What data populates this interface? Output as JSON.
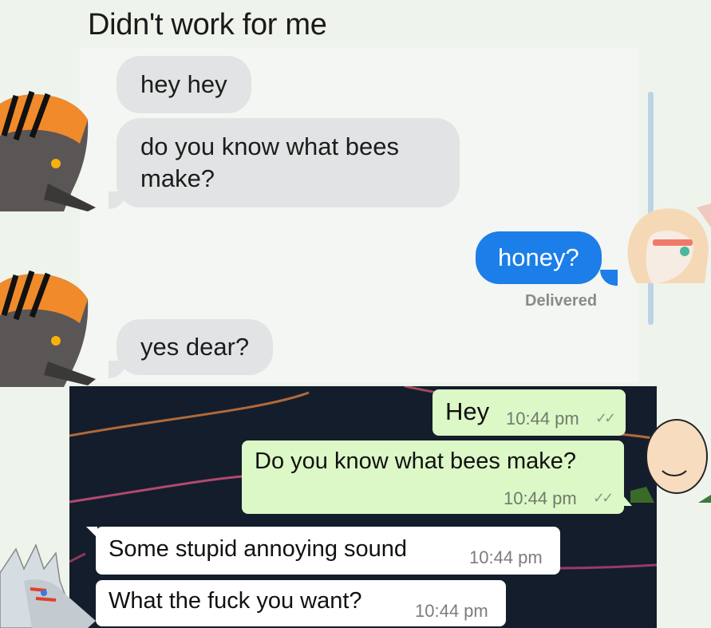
{
  "title": "Didn't work for me",
  "imessage": {
    "messages": [
      {
        "side": "received",
        "text": "hey hey"
      },
      {
        "side": "received",
        "text": "do you know what bees make?"
      },
      {
        "side": "sent",
        "text": "honey?"
      },
      {
        "side": "received",
        "text": "yes dear?"
      }
    ],
    "delivered_label": "Delivered"
  },
  "whatsapp": {
    "messages": [
      {
        "side": "sent",
        "text": "Hey",
        "time": "10:44 pm"
      },
      {
        "side": "sent",
        "text": "Do you know what bees make?",
        "time": "10:44 pm"
      },
      {
        "side": "received",
        "text": "Some stupid annoying sound",
        "time": "10:44 pm"
      },
      {
        "side": "received",
        "text": "What the fuck you want?",
        "time": "10:44 pm"
      }
    ],
    "read_tick": "✓✓"
  },
  "colors": {
    "imessage_blue": "#1c7ee8",
    "imessage_grey": "#e2e3e4",
    "whatsapp_sent": "#dcf8c6",
    "whatsapp_bg": "#141d2b"
  }
}
